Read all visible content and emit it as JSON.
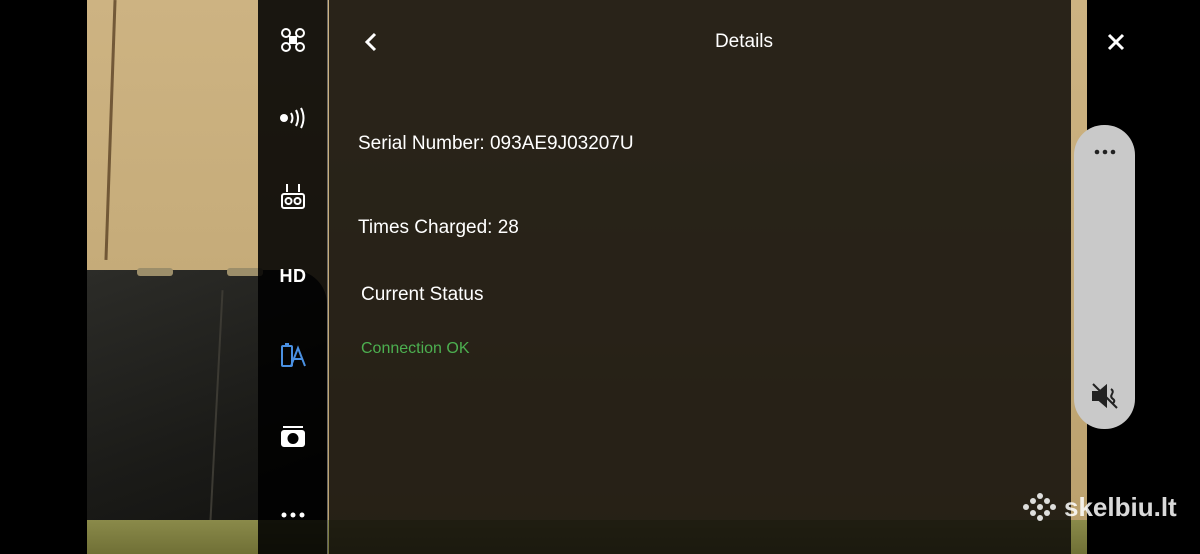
{
  "header": {
    "title": "Details",
    "back_icon": "chevron-left-icon",
    "close_icon": "close-icon"
  },
  "rail": {
    "items": [
      {
        "name": "aircraft-icon"
      },
      {
        "name": "signal-icon"
      },
      {
        "name": "remote-controller-icon"
      },
      {
        "name": "hd",
        "label": "HD"
      },
      {
        "name": "battery-status-icon",
        "active": true,
        "color": "#4a90e2"
      },
      {
        "name": "camera-icon"
      },
      {
        "name": "more-icon"
      }
    ]
  },
  "details": {
    "serial_number": "Serial Number: 093AE9J03207U",
    "times_charged": "Times Charged: 28",
    "current_status_label": "Current Status",
    "status_value": "Connection OK",
    "status_color": "#4caf50"
  },
  "side_pill": {
    "more_icon": "more-icon",
    "mute_icon": "mute-icon"
  },
  "watermark": {
    "text": "skelbiu.lt",
    "logo": "dots-logo-icon"
  }
}
